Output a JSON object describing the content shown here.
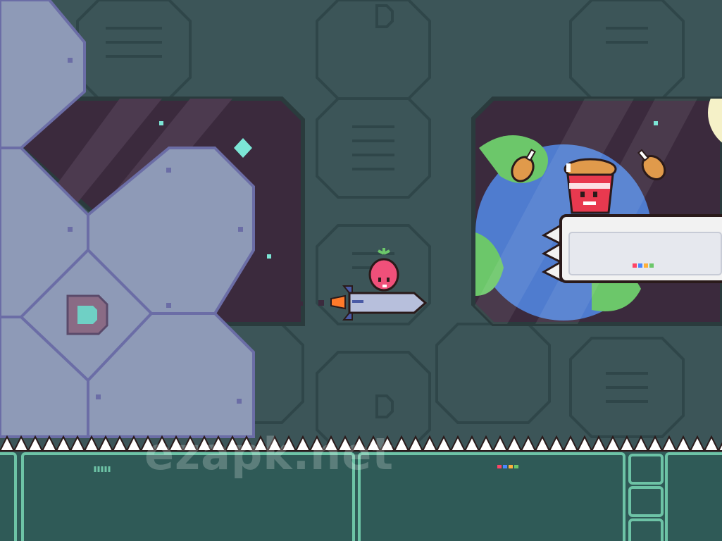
{
  "watermark": "ezapk.net",
  "colors": {
    "wall": "#3c5558",
    "wall_dark": "#2f4649",
    "space": "#3b2a3d",
    "space_stripe": "#4c3a4f",
    "floor": "#2f5a57",
    "floor_border": "#6dc3a6",
    "rock": "#8e9ab7",
    "rock_line": "#6b6da6",
    "accent": "#ff4466"
  },
  "icons": {
    "player": "radish-character",
    "vehicle": "rocket",
    "enemy": "fried-chicken-bucket-boss",
    "pickup": "chicken-drumstick",
    "emblem": "letter-d-emblem",
    "hazard": "spike-row"
  },
  "wall_emblem": "D"
}
